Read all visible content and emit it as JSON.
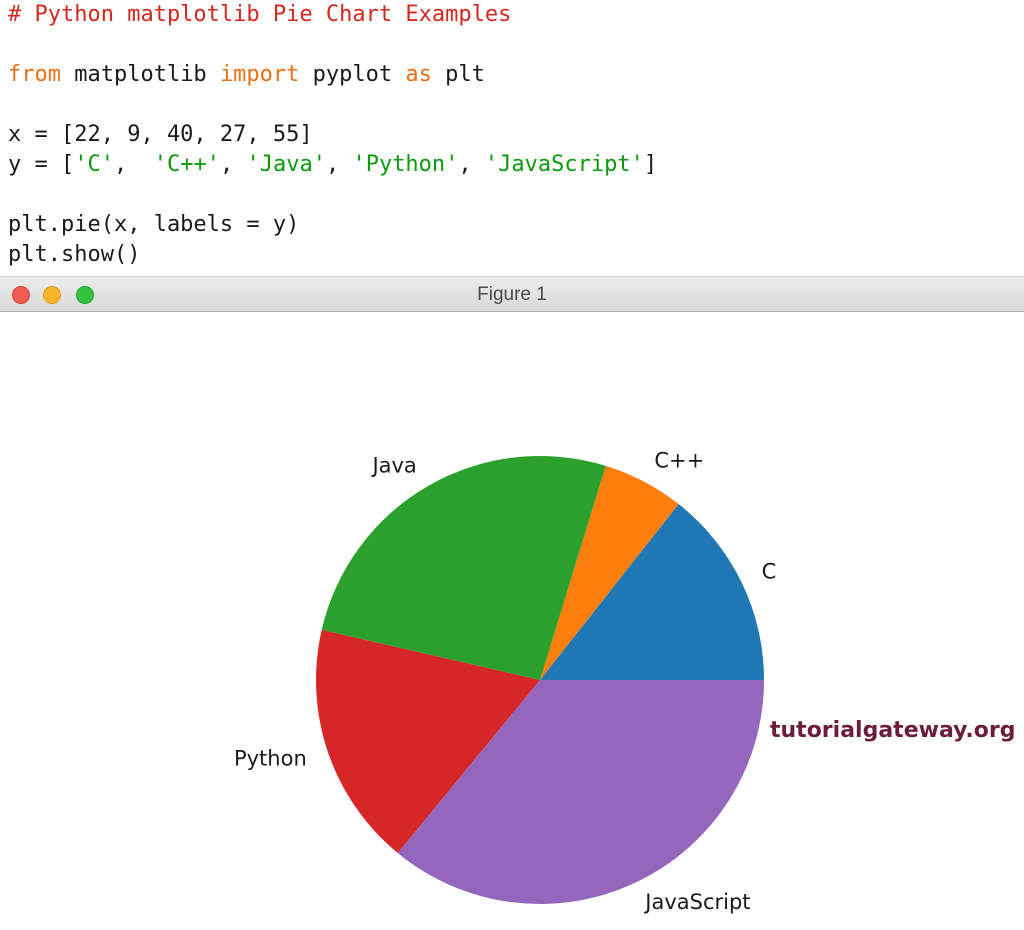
{
  "code": {
    "lines": [
      [
        {
          "t": "# Python matplotlib Pie Chart Examples",
          "k": "comment"
        }
      ],
      [],
      [
        {
          "t": "from",
          "k": "keyword"
        },
        {
          "t": " matplotlib ",
          "k": "text"
        },
        {
          "t": "import",
          "k": "keyword"
        },
        {
          "t": " pyplot ",
          "k": "text"
        },
        {
          "t": "as",
          "k": "keyword"
        },
        {
          "t": " plt",
          "k": "text"
        }
      ],
      [],
      [
        {
          "t": "x = [22, 9, 40, 27, 55]",
          "k": "text"
        }
      ],
      [
        {
          "t": "y = [",
          "k": "text"
        },
        {
          "t": "'C'",
          "k": "string"
        },
        {
          "t": ",  ",
          "k": "text"
        },
        {
          "t": "'C++'",
          "k": "string"
        },
        {
          "t": ", ",
          "k": "text"
        },
        {
          "t": "'Java'",
          "k": "string"
        },
        {
          "t": ", ",
          "k": "text"
        },
        {
          "t": "'Python'",
          "k": "string"
        },
        {
          "t": ", ",
          "k": "text"
        },
        {
          "t": "'JavaScript'",
          "k": "string"
        },
        {
          "t": "]",
          "k": "text"
        }
      ],
      [],
      [
        {
          "t": "plt.pie(x, labels = y)",
          "k": "text"
        }
      ],
      [
        {
          "t": "plt.show()",
          "k": "text"
        }
      ]
    ]
  },
  "window": {
    "title": "Figure 1"
  },
  "watermark": "tutorialgateway.org",
  "chart_data": {
    "type": "pie",
    "categories": [
      "C",
      "C++",
      "Java",
      "Python",
      "JavaScript"
    ],
    "values": [
      22,
      9,
      40,
      27,
      55
    ],
    "colors": [
      "#1f77b4",
      "#ff7f0e",
      "#2ca02c",
      "#d62728",
      "#9467bd"
    ],
    "start_angle": 0,
    "direction": "counterclockwise"
  }
}
